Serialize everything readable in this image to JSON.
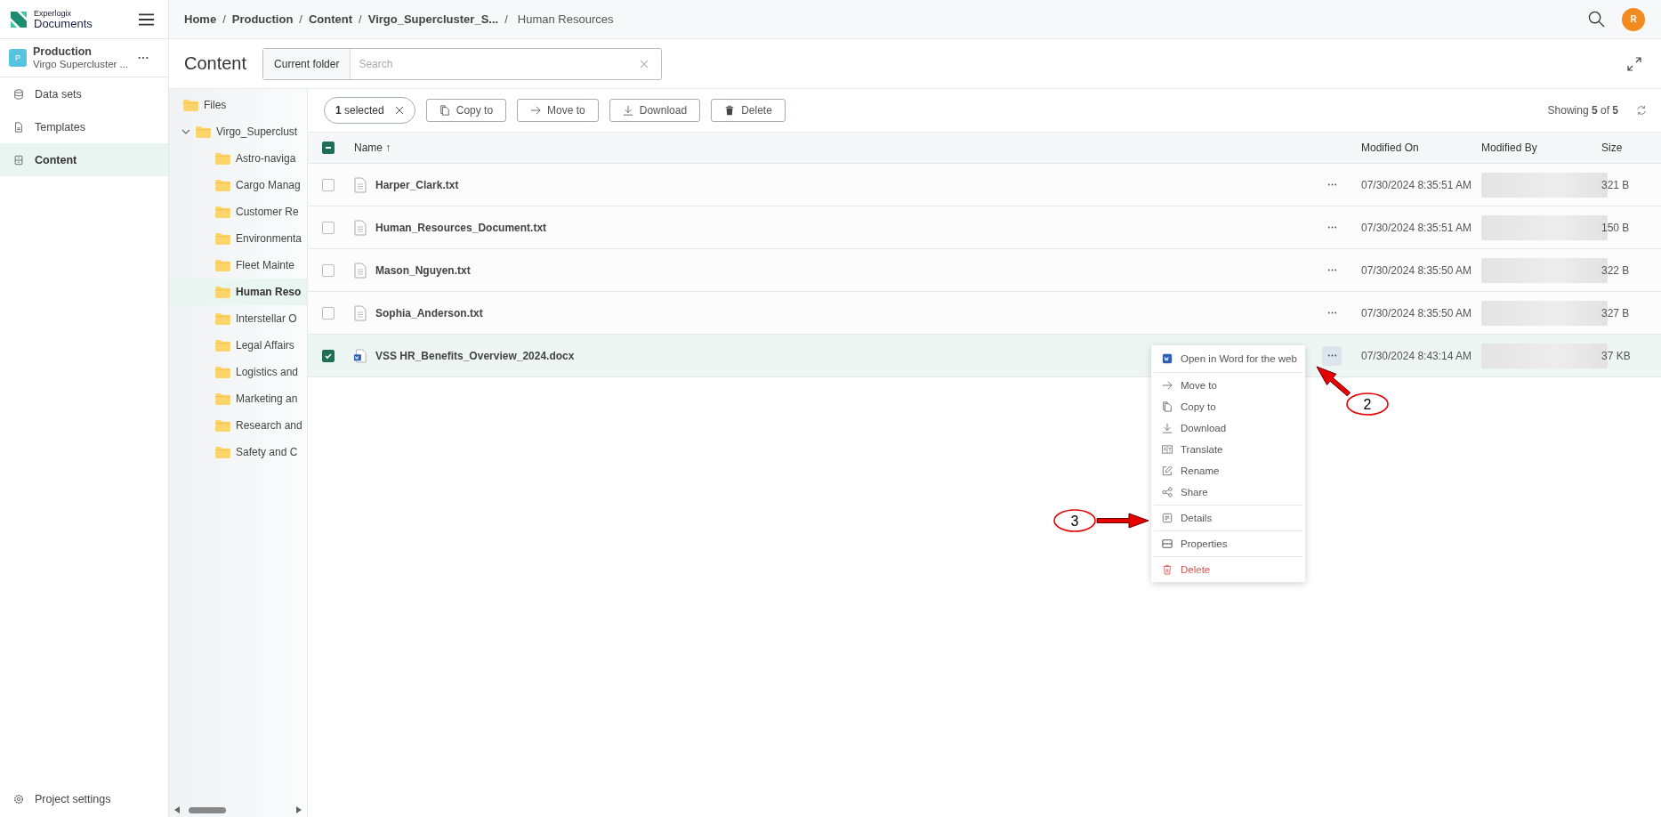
{
  "brand": {
    "line1": "Experlogix",
    "line2": "Documents"
  },
  "project": {
    "initial": "P",
    "name": "Production",
    "subtitle": "Virgo Supercluster ..."
  },
  "nav": [
    {
      "label": "Data sets",
      "kind": "database",
      "selected": false
    },
    {
      "label": "Templates",
      "kind": "template",
      "selected": false
    },
    {
      "label": "Content",
      "kind": "content",
      "selected": true
    }
  ],
  "project_settings": "Project settings",
  "breadcrumbs": [
    {
      "label": "Home",
      "current": false
    },
    {
      "separator": "/",
      "label": "Production",
      "current": false
    },
    {
      "separator": "/",
      "label": "Content",
      "current": false
    },
    {
      "separator": "/",
      "label": "Virgo_Supercluster_S...",
      "current": false
    },
    {
      "separator": "/",
      "label": "Human Resources",
      "current": true
    }
  ],
  "user": {
    "initial": "R"
  },
  "page_title": "Content",
  "search": {
    "scope": "Current folder",
    "placeholder": "Search"
  },
  "tree": [
    {
      "label": "Files",
      "selected": false
    },
    {
      "label": "Virgo_Superclust",
      "expanded": true,
      "selected": false,
      "children": [
        {
          "label": "Astro-naviga",
          "selected": false
        },
        {
          "label": "Cargo Manag",
          "selected": false
        },
        {
          "label": "Customer Re",
          "selected": false
        },
        {
          "label": "Environmenta",
          "selected": false
        },
        {
          "label": "Fleet Mainte",
          "selected": false
        },
        {
          "label": "Human Reso",
          "selected": true
        },
        {
          "label": "Interstellar O",
          "selected": false
        },
        {
          "label": "Legal Affairs",
          "selected": false
        },
        {
          "label": "Logistics and",
          "selected": false
        },
        {
          "label": "Marketing an",
          "selected": false
        },
        {
          "label": "Research and",
          "selected": false
        },
        {
          "label": "Safety and C",
          "selected": false
        }
      ]
    }
  ],
  "toolbar": {
    "selected_count": "1",
    "selected_label": "selected",
    "actions": [
      {
        "label": "Copy to",
        "kind": "copy"
      },
      {
        "label": "Move to",
        "kind": "move"
      },
      {
        "label": "Download",
        "kind": "download"
      },
      {
        "label": "Delete",
        "kind": "delete"
      }
    ],
    "showing": "Showing **5** of **5**"
  },
  "table": {
    "indeterminate": true,
    "columns": [
      {
        "label": "Name ↑"
      },
      {
        "label": "Modified On"
      },
      {
        "label": "Modified By"
      },
      {
        "label": "Size"
      }
    ],
    "rows": [
      {
        "name": "Harper_Clark.txt",
        "kind": "text",
        "modified_on": "07/30/2024 8:35:51 AM",
        "size": "321 B",
        "selected": false,
        "menu_open": false
      },
      {
        "name": "Human_Resources_Document.txt",
        "kind": "text",
        "modified_on": "07/30/2024 8:35:51 AM",
        "size": "150 B",
        "selected": false,
        "menu_open": false
      },
      {
        "name": "Mason_Nguyen.txt",
        "kind": "text",
        "modified_on": "07/30/2024 8:35:50 AM",
        "size": "322 B",
        "selected": false,
        "menu_open": false
      },
      {
        "name": "Sophia_Anderson.txt",
        "kind": "text",
        "modified_on": "07/30/2024 8:35:50 AM",
        "size": "327 B",
        "selected": false,
        "menu_open": false
      },
      {
        "name": "VSS HR_Benefits_Overview_2024.docx",
        "kind": "word",
        "modified_on": "07/30/2024 8:43:14 AM",
        "size": "37 KB",
        "selected": true,
        "menu_open": true
      }
    ]
  },
  "context_menu": [
    [
      {
        "label": "Open in Word for the web",
        "kind": "word"
      }
    ],
    [
      {
        "label": "Move to",
        "kind": "move"
      },
      {
        "label": "Copy to",
        "kind": "copy"
      },
      {
        "label": "Download",
        "kind": "download"
      },
      {
        "label": "Translate",
        "kind": "translate"
      },
      {
        "label": "Rename",
        "kind": "rename"
      },
      {
        "label": "Share",
        "kind": "share"
      }
    ],
    [
      {
        "label": "Details",
        "kind": "details"
      }
    ],
    [
      {
        "label": "Properties",
        "kind": "properties"
      }
    ],
    [
      {
        "label": "Delete",
        "kind": "delete"
      }
    ]
  ],
  "annotations": [
    {
      "label": "2"
    },
    {
      "label": "3"
    }
  ]
}
